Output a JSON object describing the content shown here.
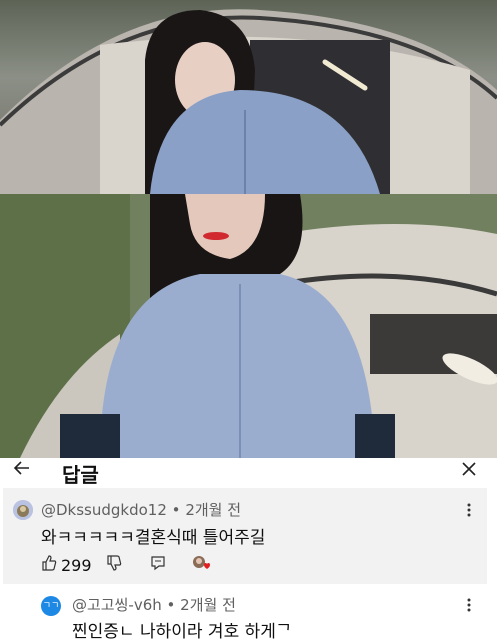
{
  "header": {
    "title": "답글",
    "back_icon": "arrow-left-icon",
    "close_icon": "close-icon"
  },
  "comment": {
    "author": "@Dkssudgkdo12",
    "separator": "•",
    "time": "2개월 전",
    "text": "와ㅋㅋㅋㅋㅋ결혼식때 틀어주길",
    "like_count": "299",
    "icons": [
      "thumbs-up-icon",
      "thumbs-down-icon",
      "reply-icon",
      "creator-heart-icon",
      "more-vert-icon"
    ]
  },
  "reply": {
    "author": "@고고씽-v6h",
    "separator": "•",
    "time": "2개월 전",
    "text": "찐인증ㄴ 나하이라 겨호 하게ᄀ",
    "avatar_text": "ㄱㄱ",
    "avatar_color": "#1e88e5"
  },
  "colors": {
    "accent_red": "#e02020",
    "comment_bg": "#f2f2f2"
  }
}
